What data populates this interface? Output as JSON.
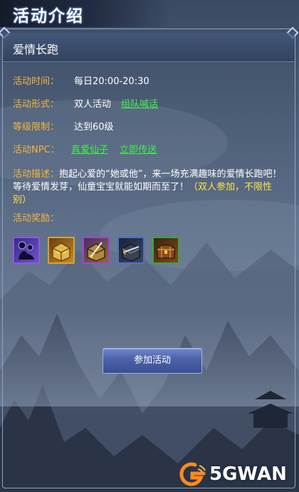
{
  "window": {
    "title": "活动介绍"
  },
  "activity": {
    "name": "爱情长跑",
    "time": {
      "label": "活动时间：",
      "value": "每日20:00-20:30"
    },
    "form": {
      "label": "活动形式：",
      "value": "双人活动",
      "link": "组队喊话"
    },
    "level": {
      "label": "等级限制：",
      "value": "达到60级"
    },
    "npc": {
      "label": "活动NPC：",
      "npc_name": "真爱仙子",
      "teleport": "立即传送"
    },
    "description": {
      "label": "活动描述：",
      "text": "抱起心爱的“她或他”，来一场充满趣味的爱情长跑吧！等待爱情发芽，仙童宝宝就能如期而至了！",
      "highlight": "（双人参加，不限性别）"
    },
    "rewards": {
      "label": "活动奖励：",
      "items": [
        {
          "icon": "figure-doll-icon",
          "border": "#8b5cd6"
        },
        {
          "icon": "gold-chest-icon",
          "border": "#d8a33a"
        },
        {
          "icon": "gold-sword-chest-icon",
          "border": "#a347c9"
        },
        {
          "icon": "dark-sword-chest-icon",
          "border": "#4b74c9"
        },
        {
          "icon": "wooden-chest-icon",
          "border": "#3aa63a"
        }
      ]
    }
  },
  "join_button": {
    "label": "参加活动"
  },
  "watermark": {
    "text": "5GWAN"
  },
  "colors": {
    "label": "#f4b63a",
    "link": "#3ef04a",
    "highlight": "#ffe24a",
    "text": "#ffffff"
  }
}
